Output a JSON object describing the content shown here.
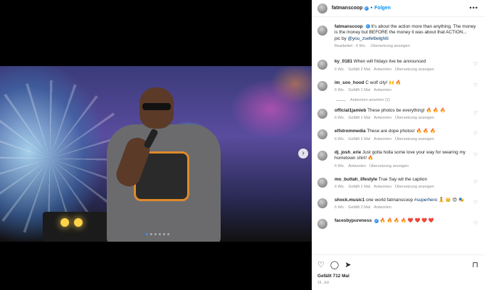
{
  "post": {
    "username": "fatmanscoop",
    "follow_label": "Folgen",
    "more_label": "•••",
    "caption_text": "It's about the action more than anything. The money is the money but BEFORE the money it was about that ACTION...",
    "credit_prefix": "pic by",
    "credit_link": "@you_zsefelbelghiti",
    "edited": "Bearbeitet · 6 Wo.",
    "translate": "Übersetzung anzeigen"
  },
  "comments": [
    {
      "user": "ky_0181",
      "text": "When will fridays live be announced",
      "age": "6 Wo.",
      "likes": "Gefällt 2 Mal",
      "reply": "Antworten",
      "translate": "Übersetzung anzeigen"
    },
    {
      "user": "im_soo_hood",
      "text": "C wolf city! 🙌 🔥",
      "age": "6 Wo.",
      "likes": "Gefällt 1 Mal",
      "reply": "Antworten",
      "translate": ""
    },
    {
      "user": "official1jamieb",
      "text": "These photos be everything! 🔥 🔥 🔥",
      "age": "6 Wo.",
      "likes": "Gefällt 1 Mal",
      "reply": "Antworten",
      "translate": "Übersetzung anzeigen"
    },
    {
      "user": "elfstrommedia",
      "text": "These are dope photos! 🔥 🔥 🔥",
      "age": "6 Wo.",
      "likes": "Gefällt 1 Mal",
      "reply": "Antworten",
      "translate": "Übersetzung anzeigen"
    },
    {
      "user": "dj_josh_erie",
      "text": "Just gotta holla some love your way for wearing my hometown shirt! 🔥",
      "age": "6 Wo.",
      "likes": "",
      "reply": "Antworten",
      "translate": "Übersetzung anzeigen"
    },
    {
      "user": "mo_buttah_lifestyle",
      "text": "True Say wit the caption",
      "age": "6 Wo.",
      "likes": "Gefällt 1 Mal",
      "reply": "Antworten",
      "translate": "Übersetzung anzeigen"
    },
    {
      "user": "shock.music1",
      "text": "one world fatmanscoop",
      "hashtag": "#superhero",
      "emojis": "🧘 👑 😍 🎭",
      "age": "6 Wo.",
      "likes": "Gefällt 2 Mal",
      "reply": "Antworten",
      "translate": ""
    },
    {
      "user": "facesbypureness",
      "text": "🔥 🔥 🔥 🔥 ❤️ ❤️ ❤️ ❤️",
      "age": "",
      "likes": "",
      "reply": "",
      "translate": ""
    }
  ],
  "replies_label": "Antworten ansehen (1)",
  "likes_total": "Gefällt 712 Mal",
  "date": "16. Juli",
  "icons": {
    "like": "heart-icon",
    "comment": "comment-icon",
    "share": "share-icon",
    "save": "bookmark-icon",
    "next": "chevron-right-icon"
  },
  "colors": {
    "link": "#00376b",
    "follow": "#0095f6",
    "verified": "#3897f0"
  }
}
